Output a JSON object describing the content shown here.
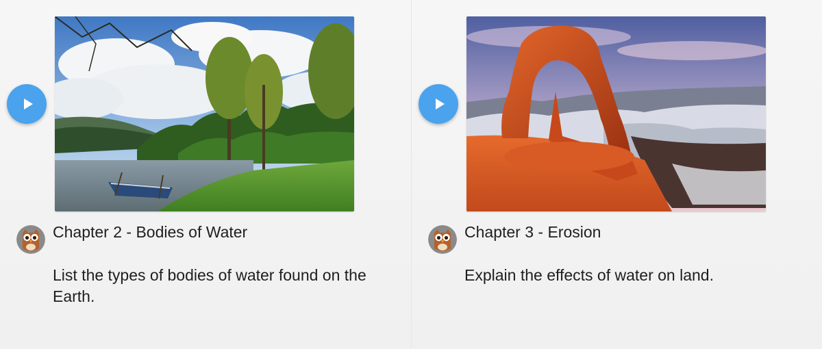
{
  "chapters": [
    {
      "title": "Chapter 2 - Bodies of Water",
      "description": "List the types of bodies of water found on the Earth.",
      "thumbnail": "lake-boat-landscape",
      "play_icon": "play-icon",
      "avatar_icon": "owl-icon"
    },
    {
      "title": "Chapter 3 - Erosion",
      "description": "Explain the effects of water on land.",
      "thumbnail": "rock-arch-landscape",
      "play_icon": "play-icon",
      "avatar_icon": "owl-icon"
    }
  ],
  "colors": {
    "play_button": "#4aa3ec",
    "text": "#1e1e1e",
    "background": "#f4f4f4"
  }
}
